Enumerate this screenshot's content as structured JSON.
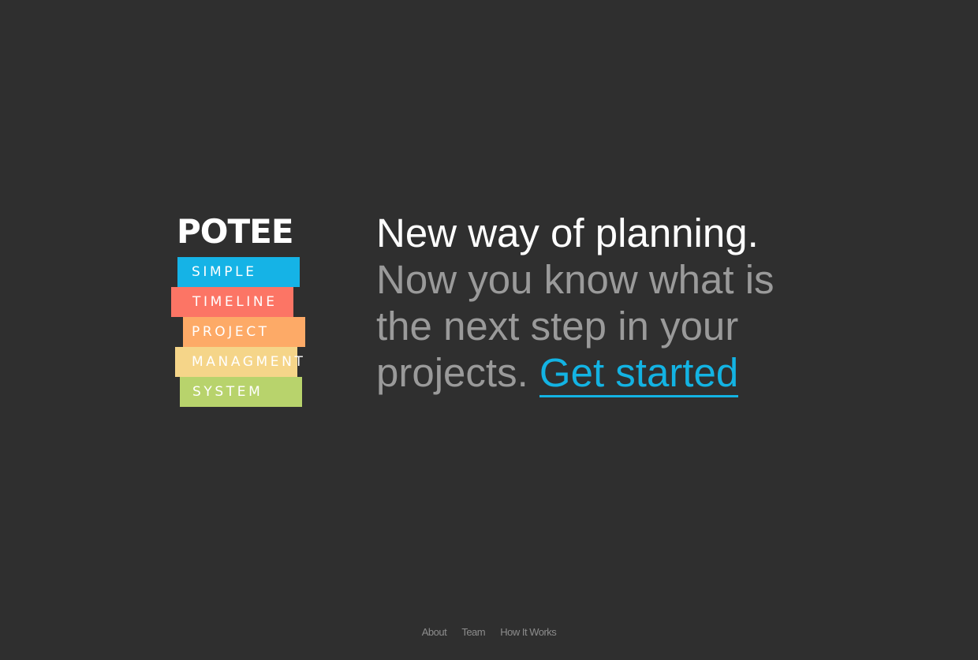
{
  "logo": {
    "title": "POTEE",
    "stripes": [
      "SIMPLE",
      "TIMELINE",
      "PROJECT",
      "MANAGMENT",
      "SYSTEM"
    ],
    "colors": [
      "#15b3e6",
      "#fc7565",
      "#fdaa67",
      "#f5d589",
      "#b8d36c"
    ]
  },
  "hero": {
    "lead": "New way of planning.",
    "body": "Now you know what is the next step in your projects.",
    "cta_label": "Get started"
  },
  "footer": {
    "links": [
      "About",
      "Team",
      "How It Works"
    ]
  },
  "colors": {
    "background": "#2f2f2f",
    "accent": "#13b3e3",
    "muted_text": "#9a9a9a"
  }
}
